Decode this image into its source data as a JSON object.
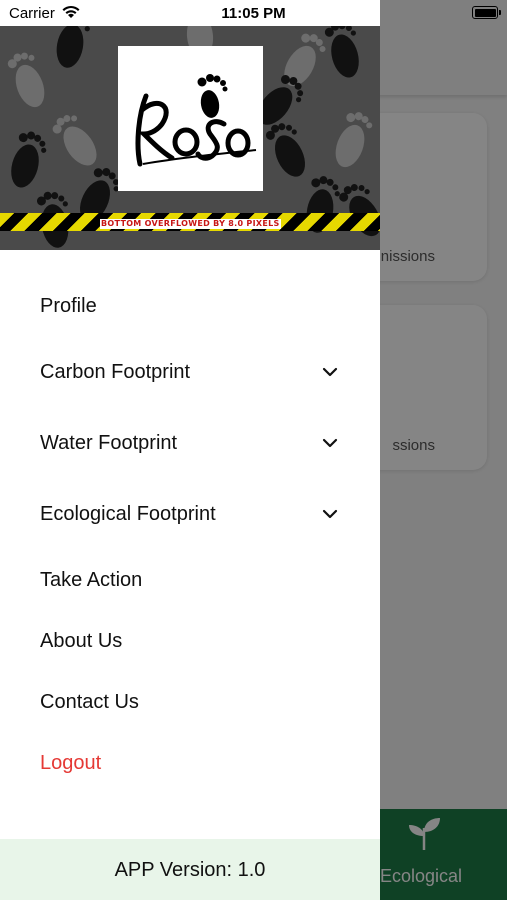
{
  "status_bar": {
    "carrier": "Carrier",
    "time": "11:05 PM"
  },
  "drawer": {
    "logo_text": "RoSo",
    "overflow_warning": "BOTTOM OVERFLOWED BY 8.0 PIXELS",
    "menu": [
      {
        "label": "Profile",
        "expandable": false
      },
      {
        "label": "Carbon Footprint",
        "expandable": true,
        "icon": "chevron-down-icon"
      },
      {
        "label": "Water Footprint",
        "expandable": true,
        "icon": "chevron-down-icon"
      },
      {
        "label": "Ecological Footprint",
        "expandable": true,
        "icon": "chevron-down-icon"
      },
      {
        "label": "Take Action",
        "expandable": false
      },
      {
        "label": "About Us",
        "expandable": false
      },
      {
        "label": "Contact Us",
        "expandable": false
      },
      {
        "label": "Logout",
        "expandable": false,
        "color": "#e53935"
      }
    ],
    "version": "APP Version: 1.0"
  },
  "background": {
    "card1_text": "nissions",
    "card2_text": "ssions",
    "bottom_nav_label": "Ecological",
    "bottom_nav_icon": "sprout-icon",
    "bottom_nav_color": "#1d7d47"
  }
}
